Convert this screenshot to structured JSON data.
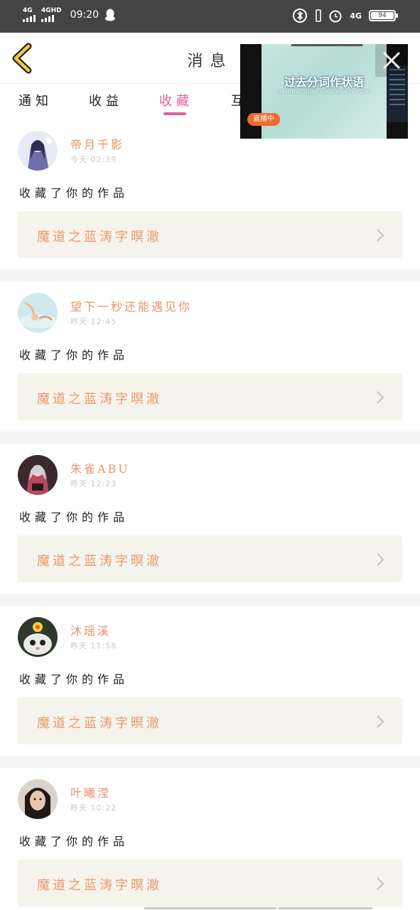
{
  "status_bar": {
    "signal1_label": "4G",
    "signal2_label": "4GHD",
    "time": "09:20",
    "network": "4G",
    "battery": "94"
  },
  "header": {
    "title": "消息"
  },
  "tabs": [
    {
      "label": "通知",
      "active": false
    },
    {
      "label": "收益",
      "active": false
    },
    {
      "label": "收藏",
      "active": true
    },
    {
      "label": "互",
      "active": false
    }
  ],
  "floating_video": {
    "caption": "过去分词作状语",
    "subtitle": "past participle used as adverbial",
    "live_badge": "直播中"
  },
  "notifications": [
    {
      "user": "帝月千影",
      "time": "今天 02:39",
      "action": "收藏了你的作品",
      "work": "魔道之蓝涛字暝澈"
    },
    {
      "user": "望下一秒还能遇见你",
      "time": "昨天 12:45",
      "action": "收藏了你的作品",
      "work": "魔道之蓝涛字暝澈"
    },
    {
      "user": "朱雀ABU",
      "time": "昨天 12:23",
      "action": "收藏了你的作品",
      "work": "魔道之蓝涛字暝澈"
    },
    {
      "user": "沐瑶溪",
      "time": "昨天 11:58",
      "action": "收藏了你的作品",
      "work": "魔道之蓝涛字暝澈"
    },
    {
      "user": "叶曦滢",
      "time": "昨天 10:22",
      "action": "收藏了你的作品",
      "work": "魔道之蓝涛字暝澈"
    }
  ],
  "colors": {
    "accent": "#e0609a",
    "username": "#e8956a",
    "work_title": "#ea9a6c",
    "status_bar": "#444444"
  }
}
